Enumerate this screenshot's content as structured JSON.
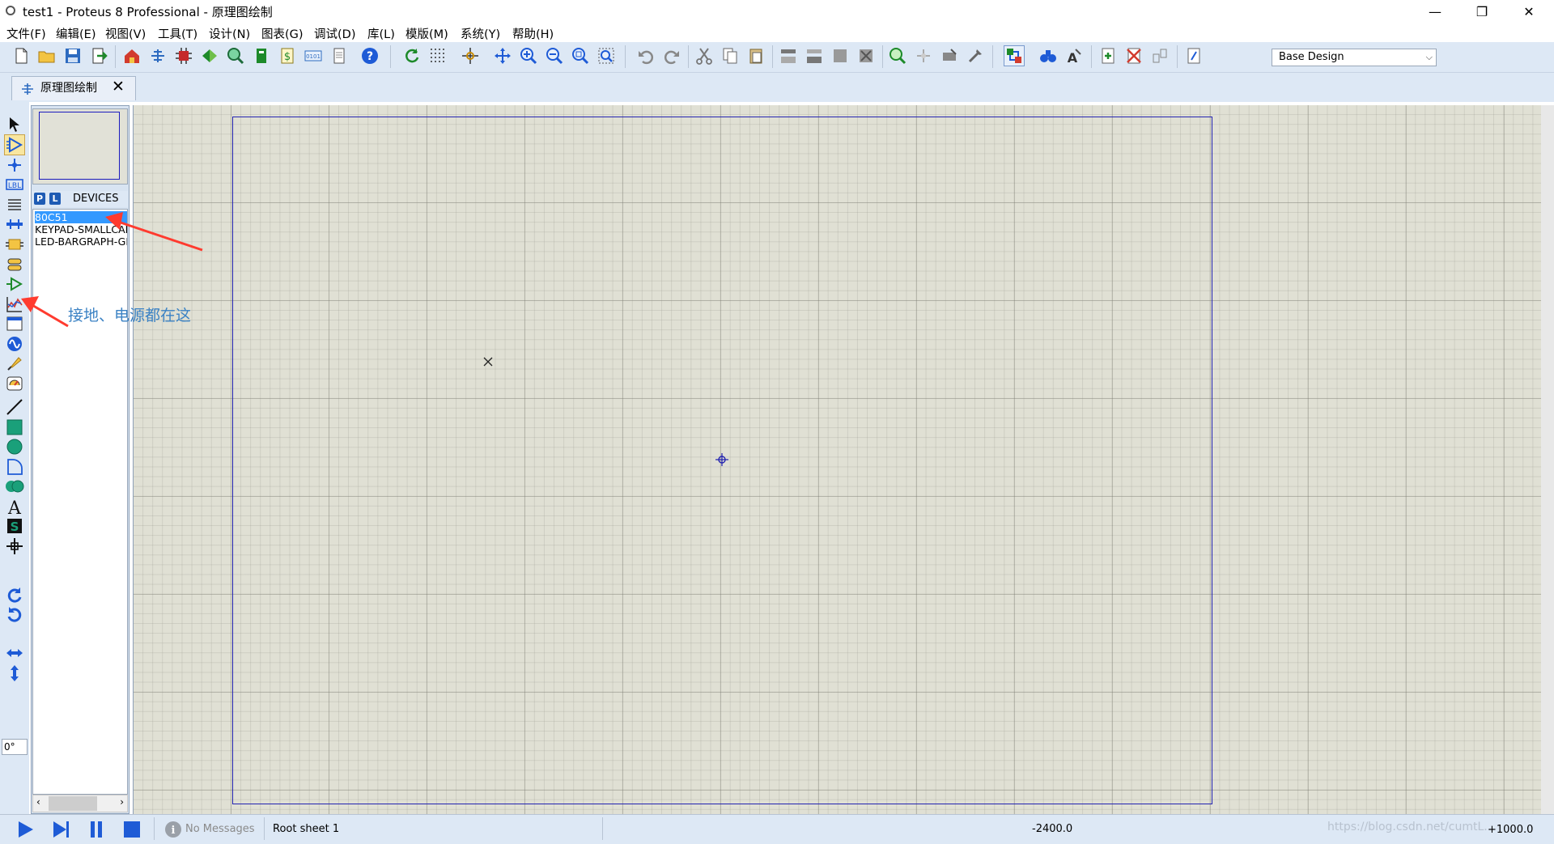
{
  "window": {
    "title": "test1 - Proteus 8 Professional - 原理图绘制",
    "minimize": "—",
    "restore": "❐",
    "close": "✕"
  },
  "menu": [
    "文件(F)",
    "编辑(E)",
    "视图(V)",
    "工具(T)",
    "设计(N)",
    "图表(G)",
    "调试(D)",
    "库(L)",
    "模版(M)",
    "系统(Y)",
    "帮助(H)"
  ],
  "toolbar": {
    "design_select": "Base Design"
  },
  "tab": {
    "label": "原理图绘制",
    "close": "✕"
  },
  "device_panel": {
    "p_button": "P",
    "l_button": "L",
    "title": "DEVICES",
    "devices": [
      "80C51",
      "KEYPAD-SMALLCALC",
      "LED-BARGRAPH-GRN"
    ],
    "selected": "80C51"
  },
  "rotation": {
    "angle": "0°"
  },
  "annotation": {
    "text": "接地、电源都在这"
  },
  "status": {
    "messages": "No Messages",
    "sheet": "Root sheet 1",
    "x": "-2400.0",
    "y": "+1000.0",
    "watermark": "https://blog.csdn.net/cumtL..."
  },
  "colors": {
    "toolbar_bg": "#dde8f5",
    "canvas_bg": "#e0e0d4",
    "sheet_border": "#2323b0",
    "selection": "#3399ff",
    "annotation": "#3b82c4",
    "arrow": "#ff3b2f"
  }
}
